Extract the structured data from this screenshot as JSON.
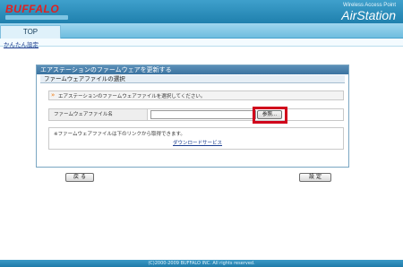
{
  "header": {
    "brand": "BUFFALO",
    "subtitle": "Wireless Access Point",
    "product": "AirStation"
  },
  "nav": {
    "tab_top": "TOP",
    "sub_item": "かんたん設定"
  },
  "panel": {
    "title": "エアステーションのファームウェアを更新する",
    "section_title": "ファームウェアファイルの選択",
    "instruction": "エアステーションのファームウェアファイルを選択してください。",
    "file_label": "ファームウェアファイル名",
    "file_value": "",
    "browse_label": "参照...",
    "note": "※ファームウェアファイルは下のリンクから取得できます。",
    "download_link": "ダウンロードサービス"
  },
  "buttons": {
    "back": "戻 る",
    "set": "設 定"
  },
  "footer": {
    "copyright": "(C)2000-2009 BUFFALO INC. All rights reserved."
  },
  "colors": {
    "header_blue": "#1f80ad",
    "brand_red": "#e02020",
    "highlight_red": "#d0021b",
    "accent_orange": "#f07a10",
    "link_blue": "#1a3d8f"
  },
  "icons": {
    "instruction": "arrow-bullet-icon"
  }
}
